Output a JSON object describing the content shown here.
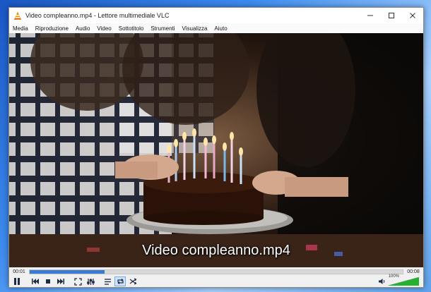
{
  "window": {
    "title": "Video compleanno.mp4 - Lettore multimediale VLC"
  },
  "menu": [
    "Media",
    "Riproduzione",
    "Audio",
    "Video",
    "Sottotitolo",
    "Strumenti",
    "Visualizza",
    "Aiuto"
  ],
  "video": {
    "subtitle": "Video compleanno.mp4"
  },
  "playback": {
    "elapsed": "00:01",
    "total": "00:08",
    "progress_fraction": 0.2
  },
  "volume": {
    "label": "100%",
    "level_fraction": 1.0
  },
  "colors": {
    "accent": "#3a7bd5",
    "volume_green": "#27b030"
  },
  "icons": [
    "vlc-cone-icon",
    "minimize-icon",
    "maximize-icon",
    "close-icon",
    "pause-icon",
    "previous-icon",
    "stop-icon",
    "next-icon",
    "fullscreen-icon",
    "extended-settings-icon",
    "playlist-icon",
    "loop-icon",
    "shuffle-icon",
    "speaker-icon"
  ]
}
